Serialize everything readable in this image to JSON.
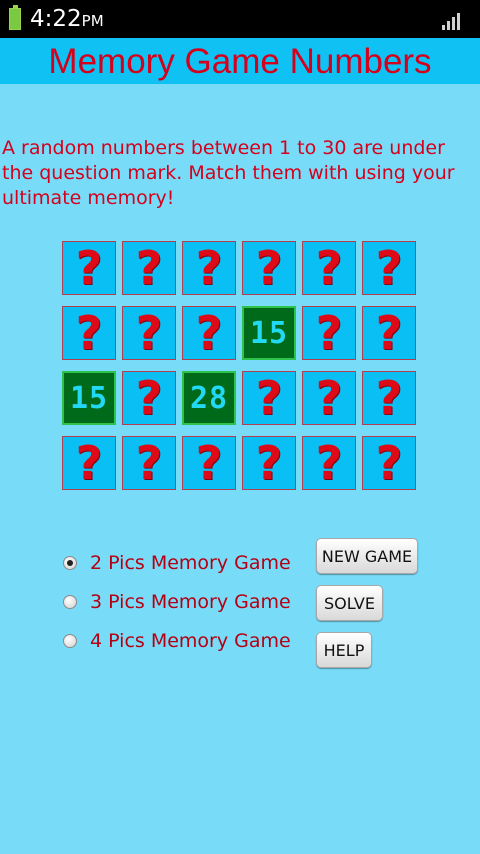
{
  "status": {
    "time": "4:22",
    "ampm": "PM"
  },
  "title": "Memory Game Numbers",
  "description": "A random numbers between 1 to 30 are under the question mark. Match them with using your ultimate memory!",
  "board": {
    "hidden_symbol": "?",
    "rows": [
      [
        null,
        null,
        null,
        null,
        null,
        null
      ],
      [
        null,
        null,
        null,
        "15",
        null,
        null
      ],
      [
        "15",
        null,
        "28",
        null,
        null,
        null
      ],
      [
        null,
        null,
        null,
        null,
        null,
        null
      ]
    ]
  },
  "options": [
    {
      "label": "2 Pics Memory Game",
      "selected": true
    },
    {
      "label": "3 Pics Memory Game",
      "selected": false
    },
    {
      "label": "4 Pics Memory Game",
      "selected": false
    }
  ],
  "buttons": {
    "new_game": "NEW GAME",
    "solve": "SOLVE",
    "help": "HELP"
  },
  "colors": {
    "background": "#78dcf9",
    "title_bar": "#10c1f3",
    "accent_red": "#d4001c",
    "tile": "#09bff4",
    "open_tile": "#006a1b"
  }
}
